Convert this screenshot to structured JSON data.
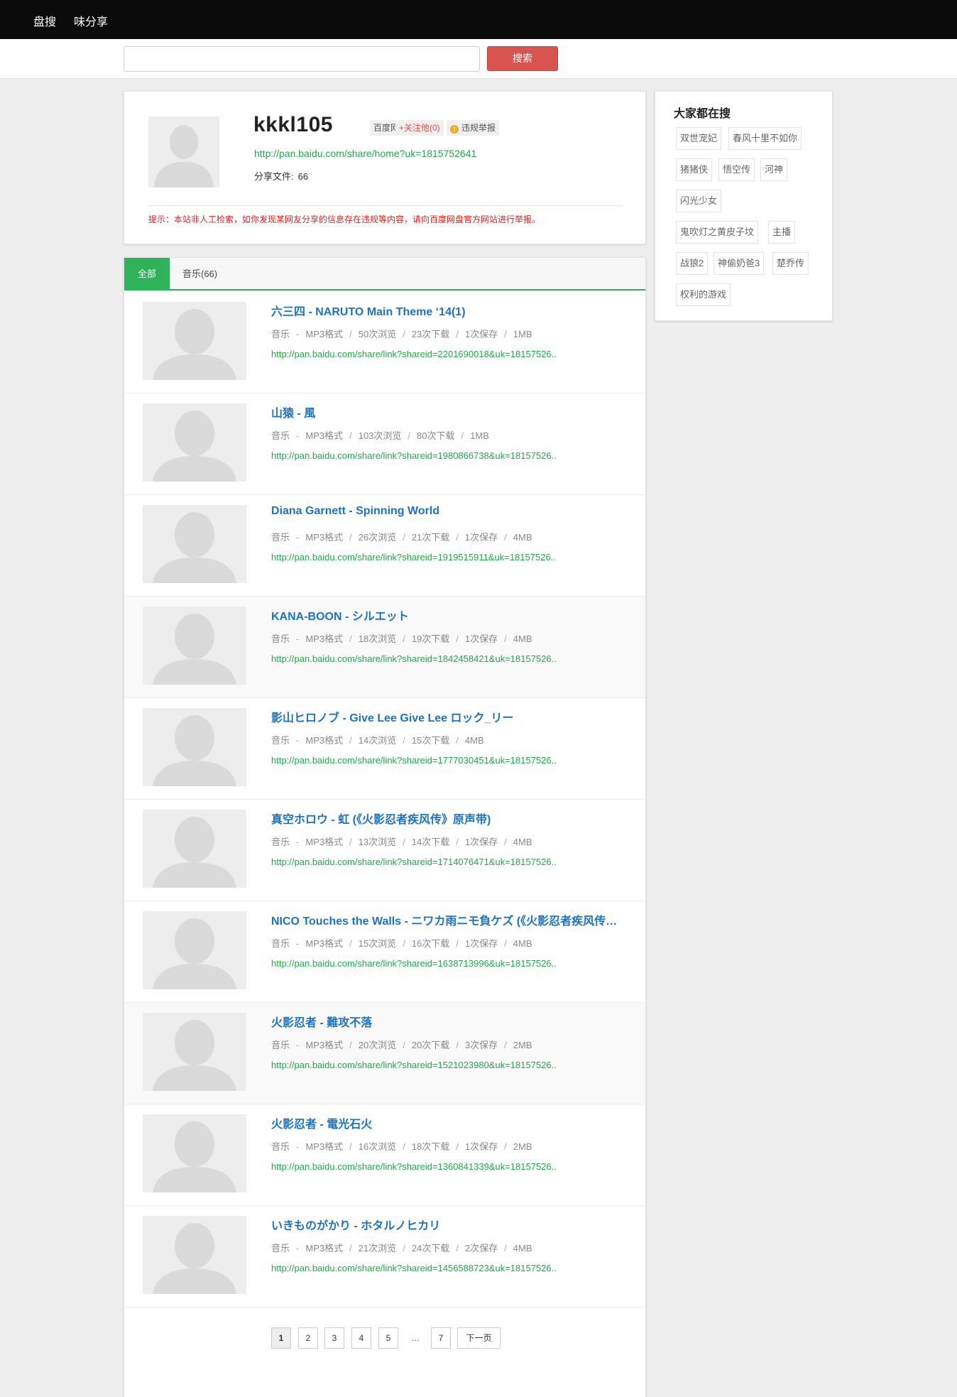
{
  "nav": {
    "items": [
      "盘搜",
      "味分享"
    ]
  },
  "search": {
    "placeholder": "",
    "button_label": "搜索"
  },
  "profile": {
    "username": "kkkl105",
    "tag_baidu": "百度网盘",
    "tag_follow": "+关注他(0)",
    "tag_report": "违规举报",
    "home_url": "http://pan.baidu.com/share/home?uk=1815752641",
    "share_label": "分享文件:",
    "share_count": "66",
    "notice": "提示：本站非人工检索，如你发现某网友分享的信息存在违规等内容，请向百度网盘官方网站进行举报。"
  },
  "tabs": [
    "全部",
    "音乐(66)"
  ],
  "files": [
    {
      "title": "六三四 - NARUTO Main Theme ‘14(1)",
      "category": "音乐",
      "meta": [
        "MP3格式",
        "50次浏览",
        "23次下载",
        "1次保存",
        "1MB"
      ],
      "link": "http://pan.baidu.com/share/link?shareid=2201690018&uk=18157526.."
    },
    {
      "title": "山猿 - 風",
      "category": "音乐",
      "meta": [
        "MP3格式",
        "103次浏览",
        "80次下载",
        "1MB"
      ],
      "link": "http://pan.baidu.com/share/link?shareid=1980866738&uk=18157526.."
    },
    {
      "title": "Diana Garnett - Spinning World",
      "category": "音乐",
      "meta": [
        "MP3格式",
        "26次浏览",
        "21次下载",
        "1次保存",
        "4MB"
      ],
      "link": "http://pan.baidu.com/share/link?shareid=1919515911&uk=18157526.."
    },
    {
      "title": "KANA-BOON - シルエット",
      "category": "音乐",
      "meta": [
        "MP3格式",
        "18次浏览",
        "19次下载",
        "1次保存",
        "4MB"
      ],
      "link": "http://pan.baidu.com/share/link?shareid=1842458421&uk=18157526.."
    },
    {
      "title": "影山ヒロノブ - Give Lee Give Lee ロック_リー",
      "category": "音乐",
      "meta": [
        "MP3格式",
        "14次浏览",
        "15次下载",
        "4MB"
      ],
      "link": "http://pan.baidu.com/share/link?shareid=1777030451&uk=18157526.."
    },
    {
      "title": "真空ホロウ - 虹 (《火影忍者疾风传》原声带)",
      "category": "音乐",
      "meta": [
        "MP3格式",
        "13次浏览",
        "14次下载",
        "1次保存",
        "4MB"
      ],
      "link": "http://pan.baidu.com/share/link?shareid=1714076471&uk=18157526.."
    },
    {
      "title": "NICO Touches the Walls - ニワカ雨ニモ負ケズ (《火影忍者疾风传》原声带)",
      "category": "音乐",
      "meta": [
        "MP3格式",
        "15次浏览",
        "16次下载",
        "1次保存",
        "4MB"
      ],
      "link": "http://pan.baidu.com/share/link?shareid=1638713996&uk=18157526.."
    },
    {
      "title": "火影忍者 - 難攻不落",
      "category": "音乐",
      "meta": [
        "MP3格式",
        "20次浏览",
        "20次下载",
        "3次保存",
        "2MB"
      ],
      "link": "http://pan.baidu.com/share/link?shareid=1521023980&uk=18157526.."
    },
    {
      "title": "火影忍者 - 電光石火",
      "category": "音乐",
      "meta": [
        "MP3格式",
        "16次浏览",
        "18次下载",
        "1次保存",
        "2MB"
      ],
      "link": "http://pan.baidu.com/share/link?shareid=1360841339&uk=18157526.."
    },
    {
      "title": "いきものがかり - ホタルノヒカリ",
      "category": "音乐",
      "meta": [
        "MP3格式",
        "21次浏览",
        "24次下载",
        "2次保存",
        "4MB"
      ],
      "link": "http://pan.baidu.com/share/link?shareid=1456588723&uk=18157526.."
    }
  ],
  "pagination": {
    "pages": [
      "1",
      "2",
      "3",
      "4",
      "5"
    ],
    "dots": "...",
    "last": "7",
    "next": "下一页",
    "current": "1"
  },
  "sidebar": {
    "title": "大家都在搜",
    "keywords": [
      "双世宠妃",
      "春风十里不如你",
      "猪猪侠",
      "悟空传",
      "河神",
      "闪光少女",
      "鬼吹灯之黄皮子坟",
      "主播",
      "战狼2",
      "神偷奶爸3",
      "楚乔传",
      "权利的游戏"
    ]
  },
  "colors": {
    "accent_green": "#2eb35a",
    "search_red": "#d9534f",
    "title_blue": "#1e73be",
    "notice_red": "#e02020"
  }
}
